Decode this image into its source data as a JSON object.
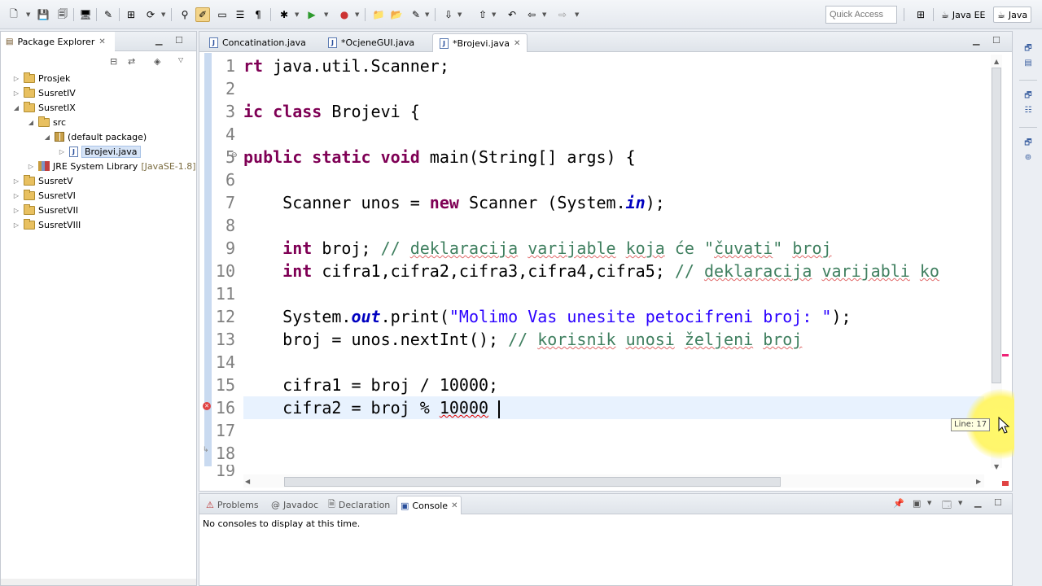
{
  "toolbar": {
    "quick_access_placeholder": "Quick Access",
    "perspectives": [
      {
        "label": "Java EE",
        "selected": false
      },
      {
        "label": "Java",
        "selected": true
      }
    ]
  },
  "package_explorer": {
    "title": "Package Explorer",
    "tree": [
      {
        "label": "Prosjek",
        "level": 0,
        "expanded": false,
        "icon": "project-folder-icon"
      },
      {
        "label": "SusretIV",
        "level": 0,
        "expanded": false,
        "icon": "project-folder-icon"
      },
      {
        "label": "SusretIX",
        "level": 0,
        "expanded": true,
        "icon": "project-folder-icon"
      },
      {
        "label": "src",
        "level": 1,
        "expanded": true,
        "icon": "source-folder-icon"
      },
      {
        "label": "(default package)",
        "level": 2,
        "expanded": true,
        "icon": "package-icon"
      },
      {
        "label": "Brojevi.java",
        "level": 3,
        "expanded": false,
        "icon": "java-file-icon",
        "selected": true
      },
      {
        "label": "JRE System Library",
        "suffix": "[JavaSE-1.8]",
        "level": 1,
        "expanded": false,
        "icon": "library-icon"
      },
      {
        "label": "SusretV",
        "level": 0,
        "expanded": false,
        "icon": "project-folder-icon"
      },
      {
        "label": "SusretVI",
        "level": 0,
        "expanded": false,
        "icon": "project-folder-icon"
      },
      {
        "label": "SusretVII",
        "level": 0,
        "expanded": false,
        "icon": "project-folder-icon"
      },
      {
        "label": "SusretVIII",
        "level": 0,
        "expanded": false,
        "icon": "project-folder-icon"
      }
    ]
  },
  "editor": {
    "tabs": [
      {
        "label": "Concatination.java",
        "active": false
      },
      {
        "label": "*OcjeneGUI.java",
        "active": false
      },
      {
        "label": "*Brojevi.java",
        "active": true
      }
    ],
    "line_numbers": [
      "1",
      "2",
      "3",
      "4",
      "5",
      "6",
      "7",
      "8",
      "9",
      "10",
      "11",
      "12",
      "13",
      "14",
      "15",
      "16",
      "17",
      "18",
      "19"
    ],
    "lines": {
      "l1_kw": "rt",
      "l1_rest": " java.util.Scanner;",
      "l3_kw": "ic class",
      "l3_rest": " Brojevi {",
      "l5_kw": "public static void",
      "l5_rest": " main(String[] args) {",
      "l7_a": "    Scanner unos = ",
      "l7_kw": "new",
      "l7_b": " Scanner (System.",
      "l7_fld": "in",
      "l7_c": ");",
      "l9_kw": "int",
      "l9_a": " broj; ",
      "l9_cm1": "// ",
      "l9_cm2": "deklaracija",
      "l9_cm3": " ",
      "l9_cm4": "varijable",
      "l9_cm5": " ",
      "l9_cm6": "koja",
      "l9_cm7": " će \"",
      "l9_cm8": "čuvati",
      "l9_cm9": "\" ",
      "l9_cm10": "broj",
      "l10_kw": "int",
      "l10_a": " cifra1,cifra2,cifra3,cifra4,cifra5; ",
      "l10_cm1": "// ",
      "l10_cm2": "deklaracija",
      "l10_cm3": " ",
      "l10_cm4": "varijabli",
      "l10_cm5": " ",
      "l10_cm6": "ko",
      "l12_a": "    System.",
      "l12_fld": "out",
      "l12_b": ".print(",
      "l12_st": "\"Molimo Vas unesite petocifreni broj: \"",
      "l12_c": ");",
      "l13_a": "    broj = unos.nextInt(); ",
      "l13_cm1": "// ",
      "l13_cm2": "korisnik",
      "l13_cm3": " ",
      "l13_cm4": "unosi",
      "l13_cm5": " ",
      "l13_cm6": "željeni",
      "l13_cm7": " ",
      "l13_cm8": "broj",
      "l15": "    cifra1 = broj / 10000;",
      "l16_a": "    cifra2 = broj % ",
      "l16_err": "10000",
      "l16_b": " "
    },
    "hover_tooltip": "Line: 17"
  },
  "console": {
    "tabs": [
      {
        "label": "Problems",
        "active": false
      },
      {
        "label": "Javadoc",
        "active": false
      },
      {
        "label": "Declaration",
        "active": false
      },
      {
        "label": "Console",
        "active": true
      }
    ],
    "message": "No consoles to display at this time."
  },
  "colors": {
    "keyword": "#7f0055",
    "comment": "#3f7f5f",
    "string": "#2a00ff",
    "field": "#0000c0",
    "current_line": "#e8f2fe",
    "error": "#e04343",
    "cursor_highlight": "#fff56c"
  }
}
